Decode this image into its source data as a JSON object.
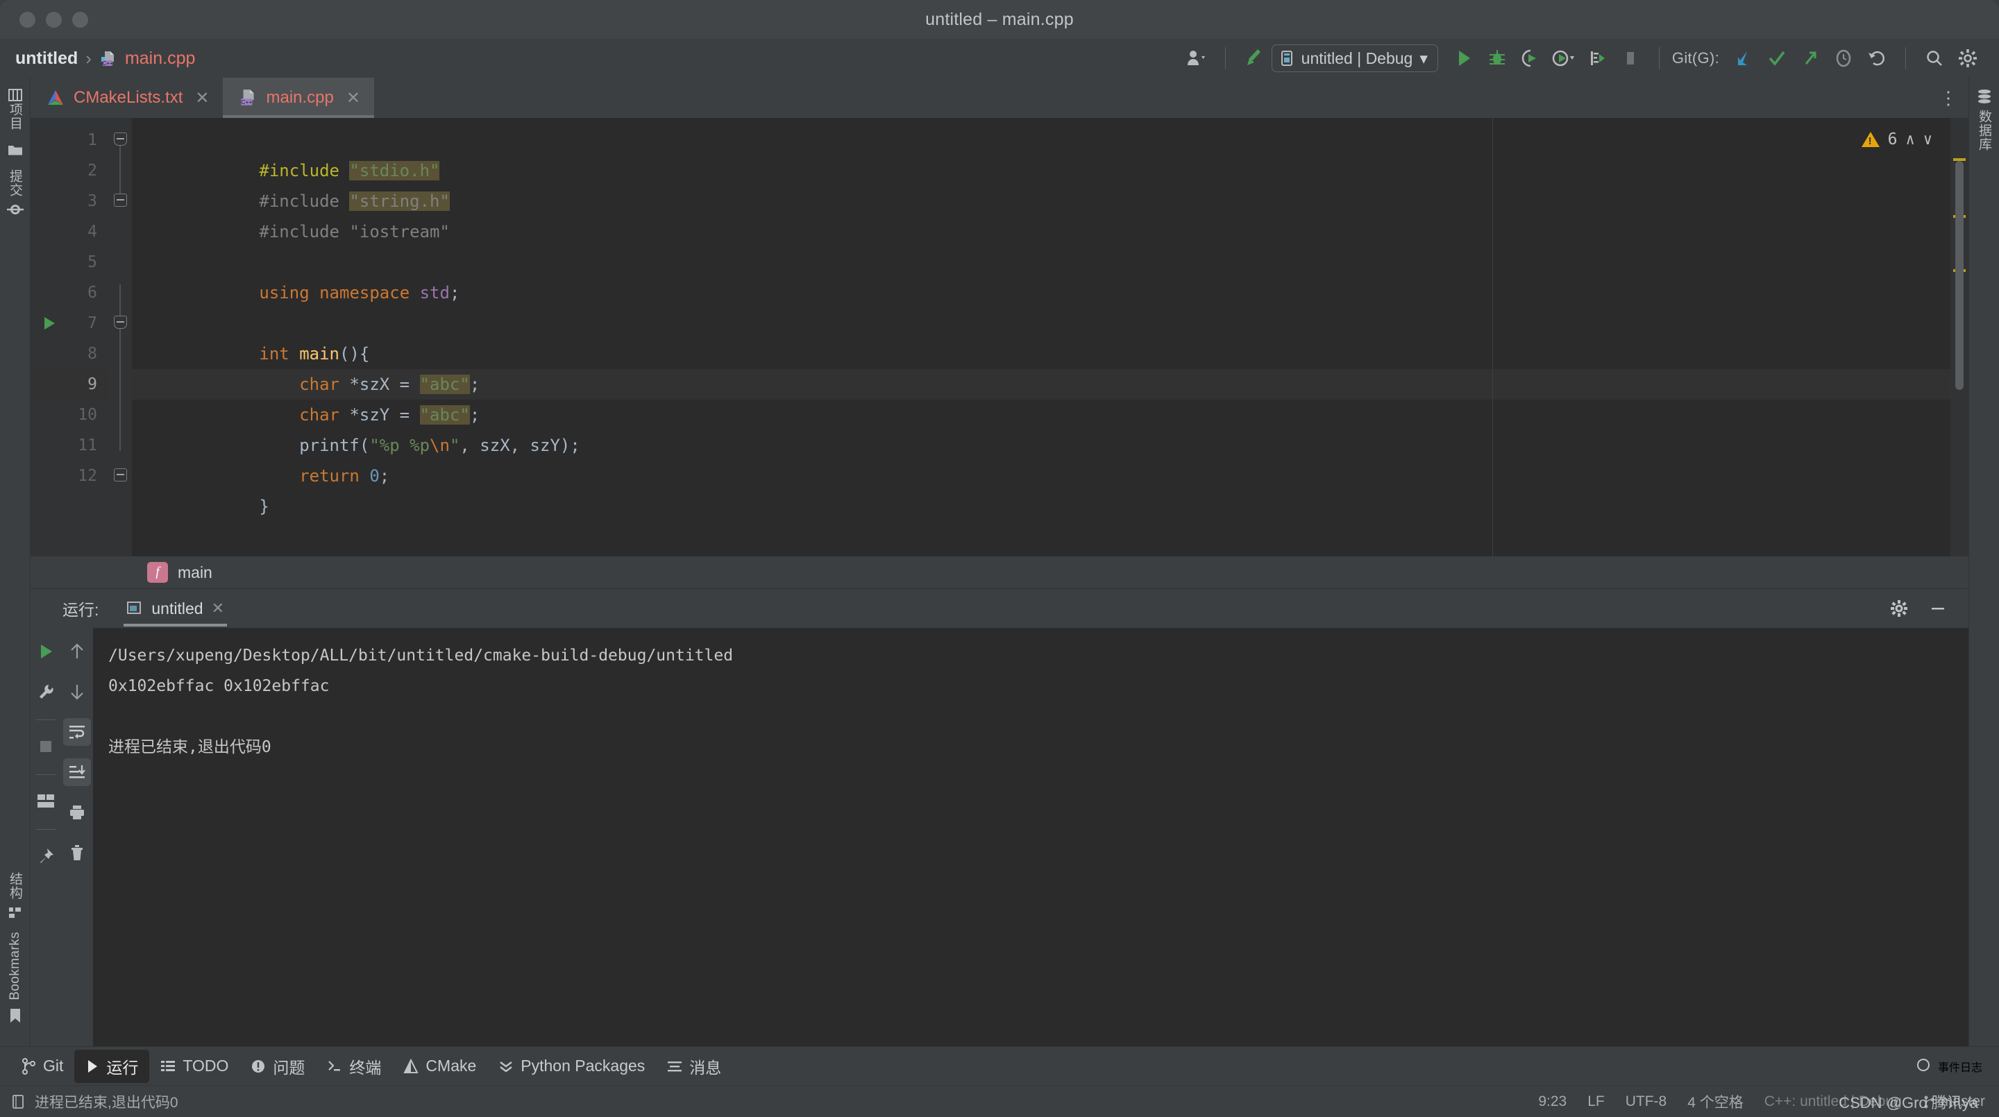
{
  "window": {
    "title": "untitled – main.cpp",
    "traffic_lights": [
      "close",
      "minimize",
      "zoom"
    ]
  },
  "toolbar": {
    "breadcrumb": {
      "project": "untitled",
      "separator": "›",
      "file": "main.cpp"
    },
    "run_config": {
      "label": "untitled | Debug",
      "chevron": "▾"
    },
    "git_label": "Git(G):",
    "buttons": [
      {
        "name": "user-avatar-button",
        "icon": "user-icon"
      },
      {
        "name": "build-button",
        "icon": "hammer-icon"
      },
      {
        "name": "run-button",
        "icon": "play-icon"
      },
      {
        "name": "debug-button",
        "icon": "bug-icon"
      },
      {
        "name": "run-with-coverage-button",
        "icon": "coverage-icon"
      },
      {
        "name": "profile-button",
        "icon": "profiler-icon"
      },
      {
        "name": "attach-process-button",
        "icon": "attach-icon"
      },
      {
        "name": "stop-button",
        "icon": "stop-icon"
      },
      {
        "name": "git-update-button",
        "icon": "update-project-icon"
      },
      {
        "name": "git-commit-button",
        "icon": "commit-check-icon"
      },
      {
        "name": "git-push-button",
        "icon": "push-arrow-icon"
      },
      {
        "name": "git-history-button",
        "icon": "history-clock-icon"
      },
      {
        "name": "git-rollback-button",
        "icon": "rollback-icon"
      },
      {
        "name": "search-everywhere-button",
        "icon": "search-icon"
      },
      {
        "name": "settings-button",
        "icon": "gear-icon"
      }
    ]
  },
  "left_rail": {
    "top_items": [
      {
        "label": "项目",
        "icon": "project-icon"
      },
      {
        "label": "",
        "icon": "folder-icon"
      },
      {
        "label": "提交",
        "icon": "commit-node-icon"
      }
    ],
    "bottom_items": [
      {
        "label": "结构",
        "icon": "structure-icon"
      },
      {
        "label": "Bookmarks",
        "icon": "bookmark-icon"
      }
    ]
  },
  "right_rail": {
    "items": [
      {
        "label": "数据库",
        "icon": "database-icon"
      }
    ]
  },
  "tabs": [
    {
      "label": "CMakeLists.txt",
      "icon": "cmake-icon",
      "active": false,
      "close": "✕"
    },
    {
      "label": "main.cpp",
      "icon": "cpp-file-icon",
      "active": true,
      "close": "✕"
    }
  ],
  "editor": {
    "kebab": "⋮",
    "inspection": {
      "warning_count": "6",
      "up": "∧",
      "down": "∨"
    },
    "line_numbers": [
      "1",
      "2",
      "3",
      "4",
      "5",
      "6",
      "7",
      "8",
      "9",
      "10",
      "11",
      "12"
    ],
    "current_line": 9,
    "run_marker_line": 7,
    "lines": [
      {
        "n": 1,
        "tokens": [
          {
            "t": "#include",
            "c": "kw2"
          },
          {
            "t": " ",
            "c": "id"
          },
          {
            "t": "\"stdio.h\"",
            "c": "str",
            "hl": true
          }
        ]
      },
      {
        "n": 2,
        "tokens": [
          {
            "t": "#include",
            "c": "dim"
          },
          {
            "t": " ",
            "c": "id"
          },
          {
            "t": "\"string.h\"",
            "c": "dim",
            "hl": true
          }
        ]
      },
      {
        "n": 3,
        "tokens": [
          {
            "t": "#include",
            "c": "dim"
          },
          {
            "t": " ",
            "c": "id"
          },
          {
            "t": "\"iostream\"",
            "c": "dim"
          }
        ]
      },
      {
        "n": 4,
        "tokens": []
      },
      {
        "n": 5,
        "tokens": [
          {
            "t": "using",
            "c": "kw"
          },
          {
            "t": " ",
            "c": "id"
          },
          {
            "t": "namespace",
            "c": "kw"
          },
          {
            "t": " ",
            "c": "id"
          },
          {
            "t": "std",
            "c": "cls"
          },
          {
            "t": ";",
            "c": "id"
          }
        ]
      },
      {
        "n": 6,
        "tokens": []
      },
      {
        "n": 7,
        "tokens": [
          {
            "t": "int",
            "c": "kw"
          },
          {
            "t": " ",
            "c": "id"
          },
          {
            "t": "main",
            "c": "fn"
          },
          {
            "t": "(){",
            "c": "id"
          }
        ]
      },
      {
        "n": 8,
        "tokens": [
          {
            "t": "    ",
            "c": "id"
          },
          {
            "t": "char",
            "c": "kw"
          },
          {
            "t": " ",
            "c": "id"
          },
          {
            "t": "*szX = ",
            "c": "id"
          },
          {
            "t": "\"abc\"",
            "c": "str",
            "hl": true
          },
          {
            "t": ";",
            "c": "id"
          }
        ]
      },
      {
        "n": 9,
        "tokens": [
          {
            "t": "    ",
            "c": "id"
          },
          {
            "t": "char",
            "c": "kw"
          },
          {
            "t": " ",
            "c": "id"
          },
          {
            "t": "*szY = ",
            "c": "id"
          },
          {
            "t": "\"abc\"",
            "c": "str",
            "hl": true
          },
          {
            "t": ";",
            "c": "id"
          }
        ]
      },
      {
        "n": 10,
        "tokens": [
          {
            "t": "    printf(",
            "c": "id"
          },
          {
            "t": "\"%p %p",
            "c": "str"
          },
          {
            "t": "\\n",
            "c": "esc"
          },
          {
            "t": "\"",
            "c": "str"
          },
          {
            "t": ", szX, szY);",
            "c": "id"
          }
        ]
      },
      {
        "n": 11,
        "tokens": [
          {
            "t": "    ",
            "c": "id"
          },
          {
            "t": "return",
            "c": "kw"
          },
          {
            "t": " ",
            "c": "id"
          },
          {
            "t": "0",
            "c": "num"
          },
          {
            "t": ";",
            "c": "id"
          }
        ]
      },
      {
        "n": 12,
        "tokens": [
          {
            "t": "}",
            "c": "id"
          }
        ]
      }
    ],
    "breadcrumb": {
      "icon_letter": "f",
      "label": "main"
    }
  },
  "run_window": {
    "header_label": "运行:",
    "tab": {
      "label": "untitled",
      "icon": "run-config-icon",
      "close": "✕"
    },
    "header_buttons": [
      {
        "name": "run-settings-button",
        "icon": "gear-icon"
      },
      {
        "name": "hide-panel-button",
        "icon": "minimize-icon"
      }
    ],
    "side_buttons": [
      {
        "name": "rerun-button",
        "icon": "play-icon"
      },
      {
        "name": "modify-run-config-button",
        "icon": "wrench-icon"
      },
      {
        "name": "stop-button",
        "icon": "stop-icon"
      },
      {
        "name": "layout-button",
        "icon": "layout-icon"
      },
      {
        "name": "pin-tab-button",
        "icon": "pin-icon"
      }
    ],
    "side_buttons2": [
      {
        "name": "prev-occurrence-button",
        "icon": "arrow-up-icon"
      },
      {
        "name": "next-occurrence-button",
        "icon": "arrow-down-icon"
      },
      {
        "name": "soft-wrap-button",
        "icon": "soft-wrap-icon",
        "active": true
      },
      {
        "name": "scroll-to-end-button",
        "icon": "scroll-end-icon",
        "active": true
      },
      {
        "name": "print-button",
        "icon": "print-icon"
      },
      {
        "name": "clear-all-button",
        "icon": "trash-icon"
      }
    ],
    "console_lines": [
      "/Users/xupeng/Desktop/ALL/bit/untitled/cmake-build-debug/untitled",
      "0x102ebffac 0x102ebffac",
      "",
      "进程已结束,退出代码0"
    ]
  },
  "tool_window_bar": {
    "items": [
      {
        "label": "Git",
        "icon": "git-branch-icon",
        "active": false
      },
      {
        "label": "运行",
        "icon": "play-icon",
        "active": true
      },
      {
        "label": "TODO",
        "icon": "todo-list-icon",
        "active": false
      },
      {
        "label": "问题",
        "icon": "problems-icon",
        "active": false
      },
      {
        "label": "终端",
        "icon": "terminal-icon",
        "active": false
      },
      {
        "label": "CMake",
        "icon": "cmake-icon",
        "active": false
      },
      {
        "label": "Python Packages",
        "icon": "python-packages-icon",
        "active": false
      },
      {
        "label": "消息",
        "icon": "messages-icon",
        "active": false
      }
    ],
    "right": {
      "label": "事件日志",
      "icon": "event-log-icon"
    }
  },
  "status_bar": {
    "left": {
      "icon": "document-icon",
      "text": "进程已结束,退出代码0"
    },
    "caret": "9:23",
    "line_sep": "LF",
    "encoding": "UTF-8",
    "indent": "4 个空格",
    "config": "C++: untitled | Debug",
    "branch": "master",
    "watermark": "CSDN @Gro 腾讯ya"
  },
  "colors": {
    "accent_green": "#499c54",
    "accent_orange": "#cc7832",
    "string_green": "#6a8759",
    "keyword_yellow": "#bbb529",
    "warning_yellow": "#e5a50a",
    "tab_red": "#e8766a",
    "editor_bg": "#2b2b2b",
    "chrome_bg": "#3c3f41",
    "gutter_bg": "#313335"
  }
}
